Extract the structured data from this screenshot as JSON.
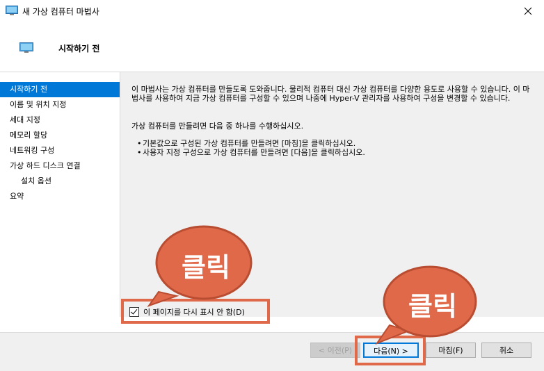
{
  "window": {
    "title": "새 가상 컴퓨터 마법사"
  },
  "header": {
    "title": "시작하기 전"
  },
  "sidebar": {
    "items": [
      {
        "label": "시작하기 전"
      },
      {
        "label": "이름 및 위치 지정"
      },
      {
        "label": "세대 지정"
      },
      {
        "label": "메모리 할당"
      },
      {
        "label": "네트워킹 구성"
      },
      {
        "label": "가상 하드 디스크 연결"
      },
      {
        "label": "설치 옵션"
      },
      {
        "label": "요약"
      }
    ]
  },
  "content": {
    "intro": "이 마법사는 가상 컴퓨터를 만들도록 도와줍니다. 물리적 컴퓨터 대신 가상 컴퓨터를 다양한 용도로 사용할 수 있습니다. 이 마법사를 사용하여 지금 가상 컴퓨터를 구성할 수 있으며 나중에 Hyper-V 관리자를 사용하여 구성을 변경할 수 있습니다.",
    "instruction": "가상 컴퓨터를 만들려면 다음 중 하나를 수행하십시오.",
    "bullets": [
      "기본값으로 구성된 가상 컴퓨터를 만들려면 [마침]을 클릭하십시오.",
      "사용자 지정 구성으로 가상 컴퓨터를 만들려면 [다음]을 클릭하십시오."
    ]
  },
  "checkbox": {
    "label": "이 페이지를 다시 표시 안 함(D)",
    "checked": true
  },
  "buttons": {
    "prev": "< 이전(P)",
    "next": "다음(N) >",
    "finish": "마침(F)",
    "cancel": "취소"
  },
  "annotations": {
    "bubble1": "클릭",
    "bubble2": "클릭"
  },
  "colors": {
    "accent": "#0078d7",
    "annotation": "#e0694a"
  }
}
